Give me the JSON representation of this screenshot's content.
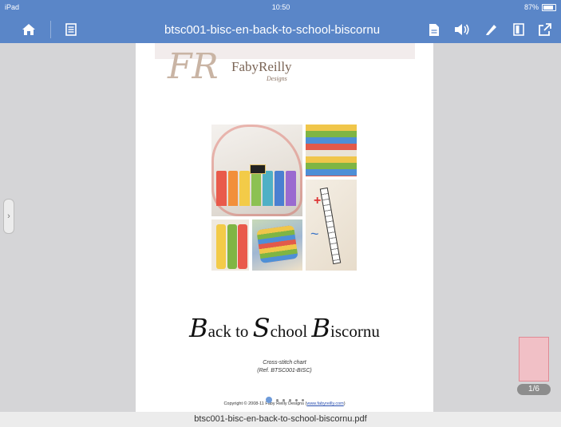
{
  "status_bar": {
    "carrier": "iPad",
    "time": "10:50",
    "battery_percent": "87%",
    "battery_level": 0.87
  },
  "toolbar": {
    "title": "btsc001-bisc-en-back-to-school-biscornu",
    "left_icons": [
      "home-icon",
      "list-icon"
    ],
    "right_icons": [
      "document-icon",
      "speaker-icon",
      "pencil-icon",
      "book-icon",
      "share-icon"
    ]
  },
  "document": {
    "logo": {
      "monogram": "FR",
      "brand_first": "Faby",
      "brand_second": "Reilly",
      "designs": "Designs"
    },
    "title_parts": [
      {
        "initial": "B",
        "rest": "ack to "
      },
      {
        "initial": "S",
        "rest": "chool "
      },
      {
        "initial": "B",
        "rest": "iscornu"
      }
    ],
    "subtitle_line1": "Cross-stitch chart",
    "subtitle_line2": "(Ref. BTSC001-BISC)",
    "copyright_prefix": "Copyright © 2008-11 Faby Reilly Designs (",
    "copyright_link": "www.fabyreilly.com",
    "copyright_suffix": ")"
  },
  "pager": {
    "dots_count": 6,
    "active_dot": 0,
    "page_counter": "1/6"
  },
  "filename": "btsc001-bisc-en-back-to-school-biscornu.pdf",
  "colors": {
    "toolbar_blue": "#5a86c8",
    "background_gray": "#d5d5d7",
    "thumb_pink": "#f1c0c6"
  }
}
